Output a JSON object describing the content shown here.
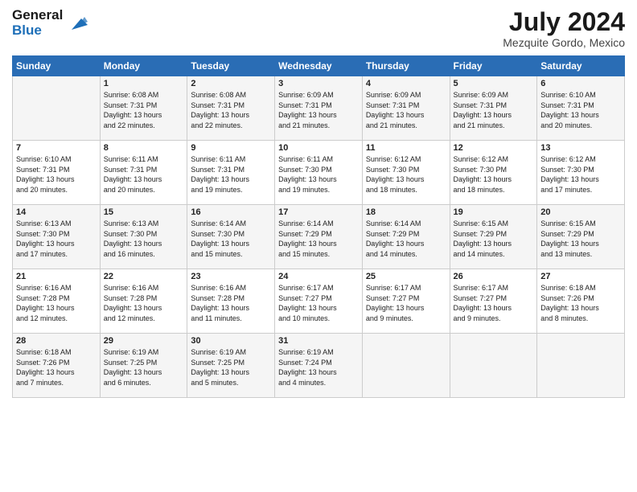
{
  "header": {
    "logo_general": "General",
    "logo_blue": "Blue",
    "month_year": "July 2024",
    "location": "Mezquite Gordo, Mexico"
  },
  "days_of_week": [
    "Sunday",
    "Monday",
    "Tuesday",
    "Wednesday",
    "Thursday",
    "Friday",
    "Saturday"
  ],
  "weeks": [
    [
      {
        "day": "",
        "info": ""
      },
      {
        "day": "1",
        "info": "Sunrise: 6:08 AM\nSunset: 7:31 PM\nDaylight: 13 hours\nand 22 minutes."
      },
      {
        "day": "2",
        "info": "Sunrise: 6:08 AM\nSunset: 7:31 PM\nDaylight: 13 hours\nand 22 minutes."
      },
      {
        "day": "3",
        "info": "Sunrise: 6:09 AM\nSunset: 7:31 PM\nDaylight: 13 hours\nand 21 minutes."
      },
      {
        "day": "4",
        "info": "Sunrise: 6:09 AM\nSunset: 7:31 PM\nDaylight: 13 hours\nand 21 minutes."
      },
      {
        "day": "5",
        "info": "Sunrise: 6:09 AM\nSunset: 7:31 PM\nDaylight: 13 hours\nand 21 minutes."
      },
      {
        "day": "6",
        "info": "Sunrise: 6:10 AM\nSunset: 7:31 PM\nDaylight: 13 hours\nand 20 minutes."
      }
    ],
    [
      {
        "day": "7",
        "info": ""
      },
      {
        "day": "8",
        "info": "Sunrise: 6:11 AM\nSunset: 7:31 PM\nDaylight: 13 hours\nand 20 minutes."
      },
      {
        "day": "9",
        "info": "Sunrise: 6:11 AM\nSunset: 7:31 PM\nDaylight: 13 hours\nand 19 minutes."
      },
      {
        "day": "10",
        "info": "Sunrise: 6:11 AM\nSunset: 7:30 PM\nDaylight: 13 hours\nand 19 minutes."
      },
      {
        "day": "11",
        "info": "Sunrise: 6:12 AM\nSunset: 7:30 PM\nDaylight: 13 hours\nand 18 minutes."
      },
      {
        "day": "12",
        "info": "Sunrise: 6:12 AM\nSunset: 7:30 PM\nDaylight: 13 hours\nand 18 minutes."
      },
      {
        "day": "13",
        "info": "Sunrise: 6:12 AM\nSunset: 7:30 PM\nDaylight: 13 hours\nand 17 minutes."
      }
    ],
    [
      {
        "day": "14",
        "info": ""
      },
      {
        "day": "15",
        "info": "Sunrise: 6:13 AM\nSunset: 7:30 PM\nDaylight: 13 hours\nand 16 minutes."
      },
      {
        "day": "16",
        "info": "Sunrise: 6:14 AM\nSunset: 7:30 PM\nDaylight: 13 hours\nand 15 minutes."
      },
      {
        "day": "17",
        "info": "Sunrise: 6:14 AM\nSunset: 7:29 PM\nDaylight: 13 hours\nand 15 minutes."
      },
      {
        "day": "18",
        "info": "Sunrise: 6:14 AM\nSunset: 7:29 PM\nDaylight: 13 hours\nand 14 minutes."
      },
      {
        "day": "19",
        "info": "Sunrise: 6:15 AM\nSunset: 7:29 PM\nDaylight: 13 hours\nand 14 minutes."
      },
      {
        "day": "20",
        "info": "Sunrise: 6:15 AM\nSunset: 7:29 PM\nDaylight: 13 hours\nand 13 minutes."
      }
    ],
    [
      {
        "day": "21",
        "info": ""
      },
      {
        "day": "22",
        "info": "Sunrise: 6:16 AM\nSunset: 7:28 PM\nDaylight: 13 hours\nand 12 minutes."
      },
      {
        "day": "23",
        "info": "Sunrise: 6:16 AM\nSunset: 7:28 PM\nDaylight: 13 hours\nand 11 minutes."
      },
      {
        "day": "24",
        "info": "Sunrise: 6:17 AM\nSunset: 7:27 PM\nDaylight: 13 hours\nand 10 minutes."
      },
      {
        "day": "25",
        "info": "Sunrise: 6:17 AM\nSunset: 7:27 PM\nDaylight: 13 hours\nand 9 minutes."
      },
      {
        "day": "26",
        "info": "Sunrise: 6:17 AM\nSunset: 7:27 PM\nDaylight: 13 hours\nand 9 minutes."
      },
      {
        "day": "27",
        "info": "Sunrise: 6:18 AM\nSunset: 7:26 PM\nDaylight: 13 hours\nand 8 minutes."
      }
    ],
    [
      {
        "day": "28",
        "info": "Sunrise: 6:18 AM\nSunset: 7:26 PM\nDaylight: 13 hours\nand 7 minutes."
      },
      {
        "day": "29",
        "info": "Sunrise: 6:19 AM\nSunset: 7:25 PM\nDaylight: 13 hours\nand 6 minutes."
      },
      {
        "day": "30",
        "info": "Sunrise: 6:19 AM\nSunset: 7:25 PM\nDaylight: 13 hours\nand 5 minutes."
      },
      {
        "day": "31",
        "info": "Sunrise: 6:19 AM\nSunset: 7:24 PM\nDaylight: 13 hours\nand 4 minutes."
      },
      {
        "day": "",
        "info": ""
      },
      {
        "day": "",
        "info": ""
      },
      {
        "day": "",
        "info": ""
      }
    ]
  ],
  "week1_sun_info": "Sunrise: 6:10 AM\nSunset: 7:31 PM\nDaylight: 13 hours\nand 20 minutes.",
  "week2_sun_info": "Sunrise: 6:10 AM\nSunset: 7:31 PM\nDaylight: 13 hours\nand 20 minutes.",
  "week3_sun_info": "Sunrise: 6:13 AM\nSunset: 7:30 PM\nDaylight: 13 hours\nand 17 minutes.",
  "week4_sun_info": "Sunrise: 6:16 AM\nSunset: 7:28 PM\nDaylight: 13 hours\nand 12 minutes."
}
